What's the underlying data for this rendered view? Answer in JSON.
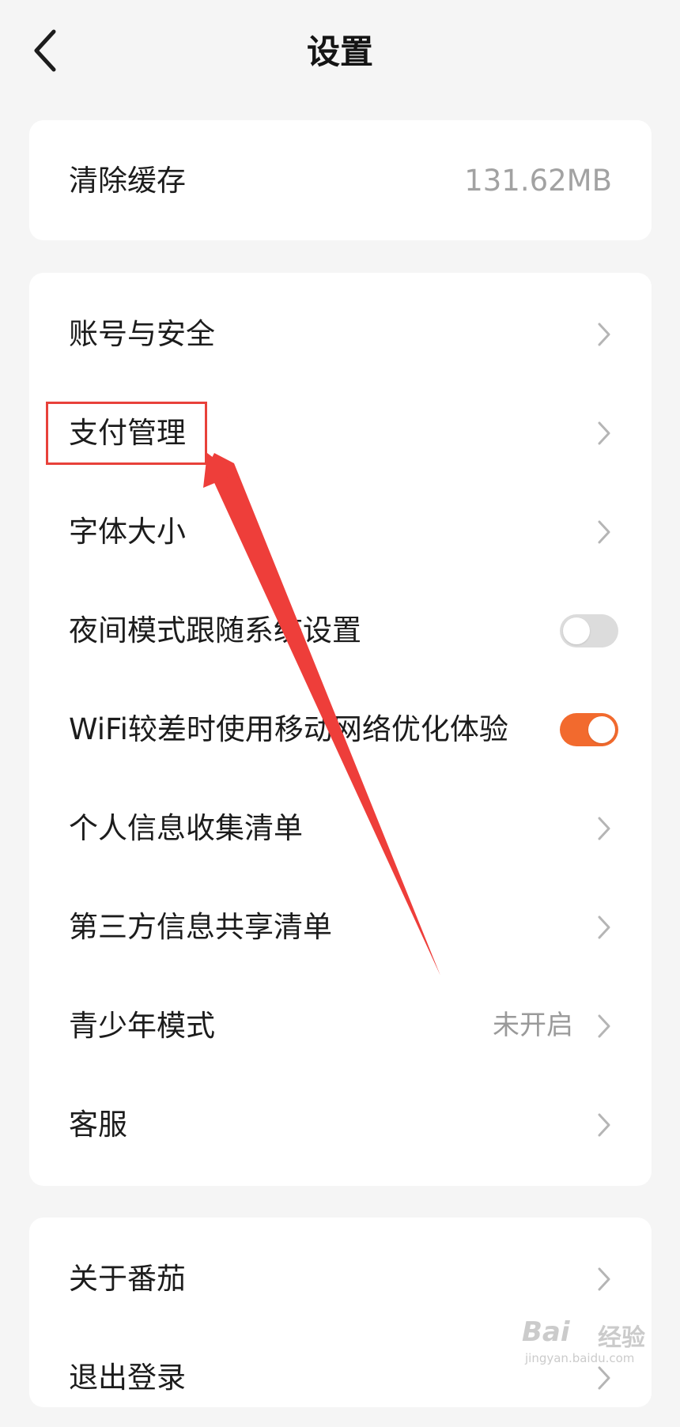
{
  "header": {
    "title": "设置"
  },
  "cache": {
    "label": "清除缓存",
    "value": "131.62MB"
  },
  "settings": {
    "account_security": "账号与安全",
    "payment_management": "支付管理",
    "font_size": "字体大小",
    "night_mode": "夜间模式跟随系统设置",
    "night_mode_on": false,
    "wifi_optimize": "WiFi较差时使用移动网络优化体验",
    "wifi_optimize_on": true,
    "personal_info_list": "个人信息收集清单",
    "third_party_list": "第三方信息共享清单",
    "youth_mode": "青少年模式",
    "youth_mode_status": "未开启",
    "customer_service": "客服"
  },
  "about": {
    "about_label": "关于番茄",
    "logout_label": "退出登录"
  },
  "annotation": {
    "color": "#e8413a"
  },
  "watermark": {
    "logo": "Bai",
    "cn": "经验",
    "site": "jingyan.baidu.com"
  },
  "colors": {
    "accent": "#f26a2e",
    "background": "#f5f5f5",
    "card": "#ffffff"
  }
}
